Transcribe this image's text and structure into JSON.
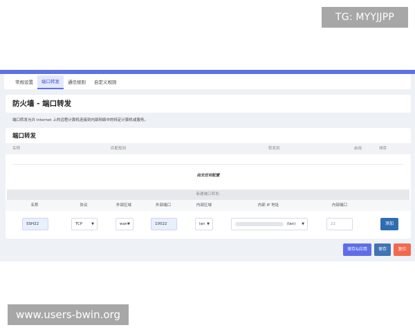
{
  "watermarks": {
    "top": "TG: MYYJJPP",
    "bottom": "www.users-bwin.org"
  },
  "tabs": [
    {
      "label": "常规设置",
      "active": false
    },
    {
      "label": "端口转发",
      "active": true
    },
    {
      "label": "通信规则",
      "active": false
    },
    {
      "label": "自定义规则",
      "active": false
    }
  ],
  "page": {
    "title": "防火墙 - 端口转发",
    "description": "端口转发允许 Internet 上的远程计算机连接到内部网络中的特定计算机或服务。"
  },
  "forwards": {
    "section_title": "端口转发",
    "columns": {
      "name": "名称",
      "match": "匹配规则",
      "forward_to": "转发到",
      "enable": "启用",
      "sort": "排序"
    },
    "empty_text": "尚无任何配置"
  },
  "new_forward": {
    "title": "新建端口转发:",
    "columns": {
      "name": "名称",
      "protocol": "协议",
      "ext_zone": "外部区域",
      "ext_port": "外部端口",
      "int_zone": "内部区域",
      "int_ip": "内部 IP 地址",
      "int_port": "内部端口"
    },
    "values": {
      "name": "SSH22",
      "protocol": "TCP",
      "ext_zone": "wan",
      "ext_port": "10022",
      "int_zone": "lan",
      "int_ip_suffix": "(lan)",
      "int_port_placeholder": "22"
    },
    "add_label": "添加"
  },
  "actions": {
    "save_apply": "保存&应用",
    "save": "保存",
    "reset": "复位"
  },
  "colors": {
    "accent": "#5e72e4",
    "add_button": "#2f6db3",
    "save_apply_button": "#5f6ee8",
    "save_button": "#3f74b5",
    "reset_button": "#f2694e"
  }
}
